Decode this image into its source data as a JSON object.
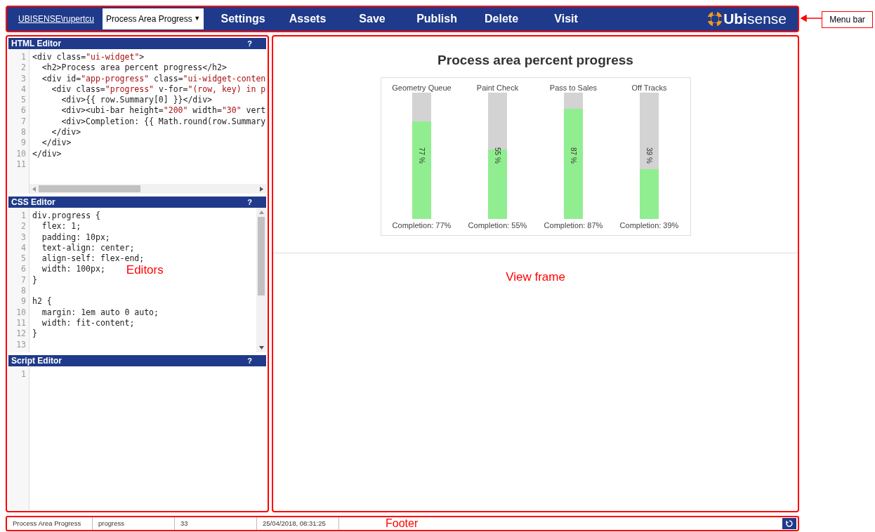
{
  "menu_bar": {
    "user": "UBISENSE\\rupertcu",
    "page_select": {
      "value": "Process Area Progress",
      "caret": "▼"
    },
    "items": [
      "Settings",
      "Assets",
      "Save",
      "Publish",
      "Delete",
      "Visit"
    ],
    "logo": {
      "text_bold": "Ubi",
      "text_light": "sense"
    }
  },
  "editors": [
    {
      "title": "HTML Editor",
      "help": "?",
      "h_scrollbar": true,
      "v_scrollbar": false,
      "lines": [
        {
          "number": "1",
          "code": "<div class=\"ui-widget\">"
        },
        {
          "number": "2",
          "code": "  <h2>Process area percent progress</h2>"
        },
        {
          "number": "3",
          "code": "  <div id=\"app-progress\" class=\"ui-widget-conten"
        },
        {
          "number": "4",
          "code": "    <div class=\"progress\" v-for=\"(row, key) in p"
        },
        {
          "number": "5",
          "code": "      <div>{{ row.Summary[0] }}</div>"
        },
        {
          "number": "6",
          "code": "      <div><ubi-bar height=\"200\" width=\"30\" vert"
        },
        {
          "number": "7",
          "code": "      <div>Completion: {{ Math.round(row.Summary"
        },
        {
          "number": "8",
          "code": "    </div>"
        },
        {
          "number": "9",
          "code": "  </div>"
        },
        {
          "number": "10",
          "code": "</div>"
        },
        {
          "number": "11"
        }
      ]
    },
    {
      "title": "CSS Editor",
      "help": "?",
      "h_scrollbar": false,
      "v_scrollbar": true,
      "lines": [
        {
          "number": "1",
          "code": "div.progress {"
        },
        {
          "number": "2",
          "code": "  flex: 1;"
        },
        {
          "number": "3",
          "code": "  padding: 10px;"
        },
        {
          "number": "4",
          "code": "  text-align: center;"
        },
        {
          "number": "5",
          "code": "  align-self: flex-end;"
        },
        {
          "number": "6",
          "code": "  width: 100px;"
        },
        {
          "number": "7",
          "code": "}"
        },
        {
          "number": "8"
        },
        {
          "number": "9",
          "code": "h2 {"
        },
        {
          "number": "10",
          "code": "  margin: 1em auto 0 auto;"
        },
        {
          "number": "11",
          "code": "  width: fit-content;"
        },
        {
          "number": "12",
          "code": "}"
        },
        {
          "number": "13"
        }
      ]
    },
    {
      "title": "Script Editor",
      "help": "?",
      "h_scrollbar": false,
      "v_scrollbar": false,
      "lines": [
        {
          "number": "1"
        }
      ]
    }
  ],
  "view": {
    "title": "Process area percent progress",
    "bars": [
      {
        "name": "Geometry Queue",
        "level": 0.77,
        "reading": "77 %",
        "completion": "Completion: 77%"
      },
      {
        "name": "Paint Check",
        "level": 0.55,
        "reading": "55 %",
        "completion": "Completion: 55%"
      },
      {
        "name": "Pass to Sales",
        "level": 0.87,
        "reading": "87 %",
        "completion": "Completion: 87%"
      },
      {
        "name": "Off Tracks",
        "level": 0.39,
        "reading": "39 %",
        "completion": "Completion: 39%"
      }
    ]
  },
  "footer": {
    "cells": [
      "Process Area Progress",
      "progress",
      "33",
      "25/04/2018, 08:31:25"
    ]
  },
  "annotations": {
    "menu_bar": "Menu bar",
    "editors": "Editors",
    "view_frame": "View frame",
    "footer": "Footer"
  }
}
